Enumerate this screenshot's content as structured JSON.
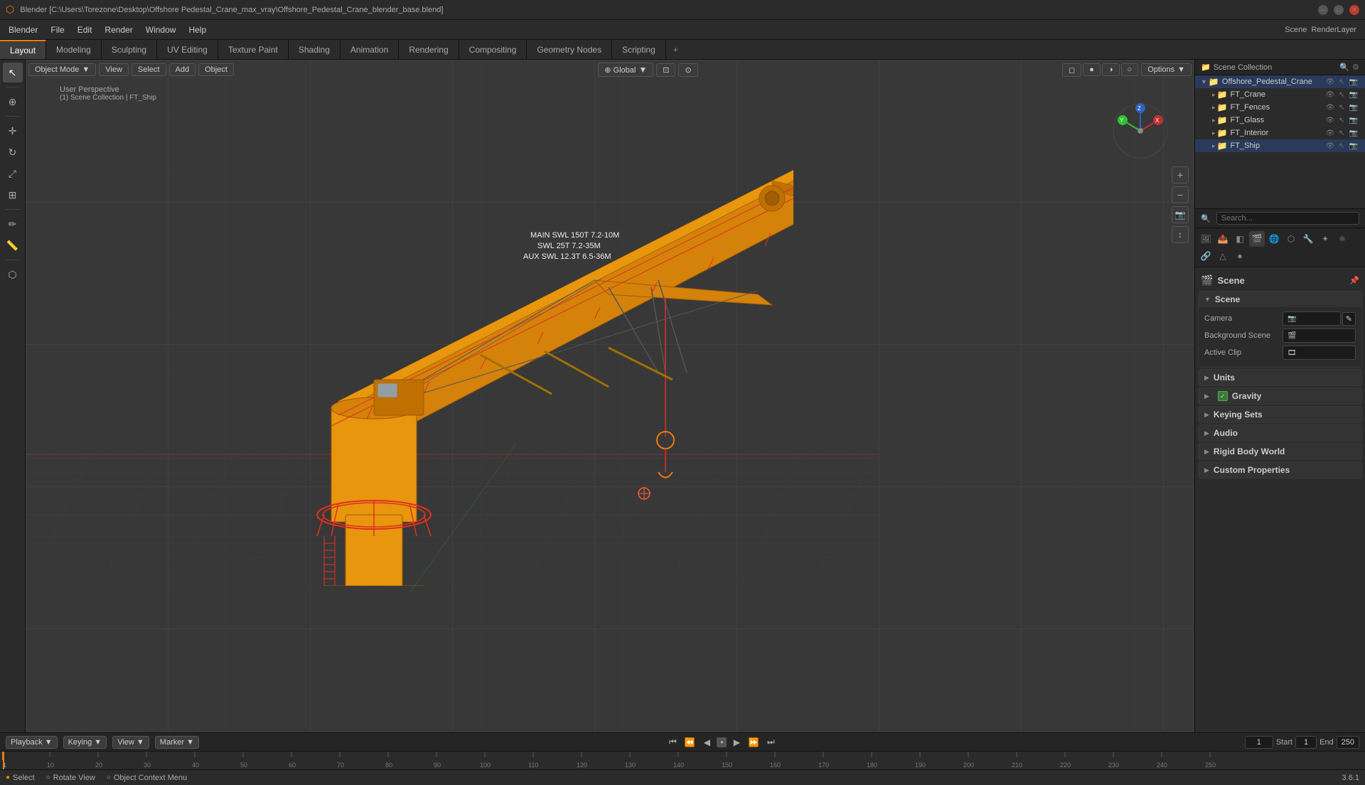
{
  "window": {
    "title": "Blender [C:\\Users\\Torezone\\Desktop\\Offshore Pedestal_Crane_max_vray\\Offshore_Pedestal_Crane_blender_base.blend]"
  },
  "menubar": {
    "items": [
      "Blender",
      "File",
      "Edit",
      "Render",
      "Window",
      "Help"
    ]
  },
  "workspace_tabs": {
    "tabs": [
      "Layout",
      "Modeling",
      "Sculpting",
      "UV Editing",
      "Texture Paint",
      "Shading",
      "Animation",
      "Rendering",
      "Compositing",
      "Geometry Nodes",
      "Scripting"
    ],
    "active": "Layout",
    "plus": "+"
  },
  "viewport": {
    "mode": "Object Mode",
    "view": "User Perspective",
    "collection": "(1) Scene Collection | FT_Ship",
    "transform": "Global",
    "options_label": "Options",
    "crane_text_main": "MAIN SWL 150T 7.2-10M",
    "crane_text_swl": "SWL  25T 7.2-35M",
    "crane_text_aux": "AUX   SWL 12.3T 6.5-36M"
  },
  "outliner": {
    "title": "Scene Collection",
    "items": [
      {
        "name": "Offshore_Pedestal_Crane",
        "level": 1,
        "icon": "▸",
        "collection": true,
        "selected": true
      },
      {
        "name": "FT_Crane",
        "level": 2,
        "icon": "▸",
        "collection": true
      },
      {
        "name": "FT_Fences",
        "level": 2,
        "icon": "▸",
        "collection": true
      },
      {
        "name": "FT_Glass",
        "level": 2,
        "icon": "▸",
        "collection": true
      },
      {
        "name": "FT_Interior",
        "level": 2,
        "icon": "▸",
        "collection": true
      },
      {
        "name": "FT_Ship",
        "level": 2,
        "icon": "▸",
        "collection": true
      }
    ]
  },
  "properties": {
    "search_placeholder": "Search...",
    "active_tab": "scene",
    "title": "Scene",
    "scene_section": {
      "title": "Scene",
      "camera_label": "Camera",
      "camera_value": "",
      "background_scene_label": "Background Scene",
      "background_scene_value": "",
      "active_clip_label": "Active Clip",
      "active_clip_value": ""
    },
    "sections": [
      {
        "id": "units",
        "title": "Units",
        "expanded": false
      },
      {
        "id": "gravity",
        "title": "Gravity",
        "expanded": false,
        "has_checkbox": true
      },
      {
        "id": "keying_sets",
        "title": "Keying Sets",
        "expanded": false
      },
      {
        "id": "audio",
        "title": "Audio",
        "expanded": false
      },
      {
        "id": "rigid_body_world",
        "title": "Rigid Body World",
        "expanded": false
      },
      {
        "id": "custom_properties",
        "title": "Custom Properties",
        "expanded": false
      }
    ],
    "icons": [
      "render",
      "output",
      "view_layer",
      "scene",
      "world",
      "object",
      "modifiers",
      "particles",
      "physics",
      "constraints",
      "data",
      "material",
      "shader"
    ]
  },
  "timeline": {
    "playback": "Playback",
    "keying": "Keying",
    "view": "View",
    "marker": "Marker",
    "current_frame": "1",
    "start": "1",
    "end": "250",
    "frame_markers": [
      "1",
      "10",
      "20",
      "30",
      "40",
      "50",
      "60",
      "70",
      "80",
      "90",
      "100",
      "110",
      "120",
      "130",
      "140",
      "150",
      "160",
      "170",
      "180",
      "190",
      "200",
      "210",
      "220",
      "230",
      "240",
      "250"
    ]
  },
  "statusbar": {
    "select": "Select",
    "rotate_view": "Rotate View",
    "context_menu": "Object Context Menu",
    "version": "3.6.1",
    "start_label": "Start",
    "end_label": "End",
    "start_val": "1",
    "end_val": "250"
  },
  "icons": {
    "scene_icon": "🎬",
    "camera_icon": "📷",
    "render_icon": "🖼",
    "object_icon": "⬡",
    "world_icon": "🌐",
    "modifier_icon": "🔧",
    "collection_icon": "📁",
    "eye_icon": "👁",
    "arrow_right": "▶",
    "arrow_down": "▼",
    "arrow_left": "◀",
    "search_icon": "🔍",
    "cursor_icon": "⊕",
    "move_icon": "✛",
    "rotate_icon": "↻",
    "scale_icon": "⤢",
    "transform_icon": "⊞"
  }
}
